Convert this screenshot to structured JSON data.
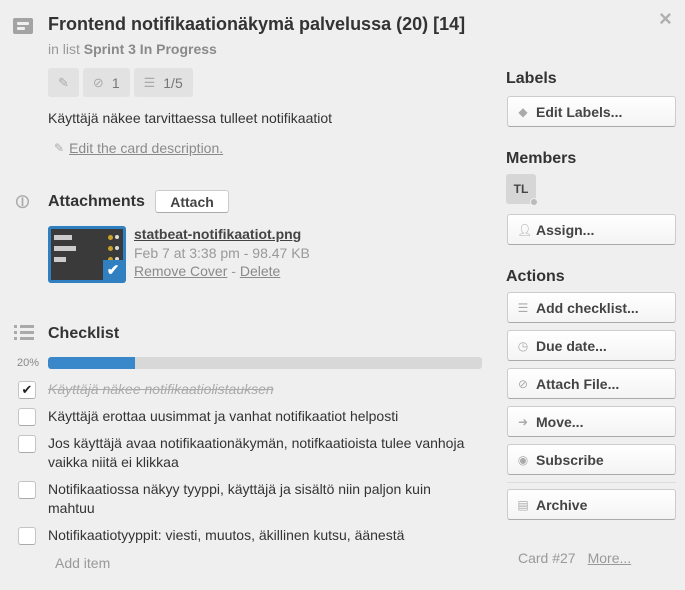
{
  "card": {
    "title": "Frontend notifikaationäkymä palvelussa (20) [14]",
    "in_list_prefix": "in list",
    "list_name": "Sprint 3 In Progress",
    "close_icon": "×",
    "badges": [
      {
        "icon": "pencil-icon",
        "glyph": "✎",
        "value": ""
      },
      {
        "icon": "paperclip-icon",
        "glyph": "⊘",
        "value": "1"
      },
      {
        "icon": "checklist-icon",
        "glyph": "☰",
        "value": "1/5"
      }
    ],
    "description": "Käyttäjä näkee tarvittaessa tulleet notifikaatiot",
    "edit_description_label": "Edit the card description."
  },
  "attachments": {
    "title": "Attachments",
    "attach_button": "Attach",
    "items": [
      {
        "filename": "statbeat-notifikaatiot.png",
        "meta": "Feb 7 at 3:38 pm - 98.47 KB",
        "remove_cover": "Remove Cover",
        "separator": " - ",
        "delete": "Delete",
        "is_cover": true
      }
    ]
  },
  "checklist": {
    "title": "Checklist",
    "progress_label": "20%",
    "progress": 0.2,
    "items": [
      {
        "text": "Käyttäjä näkee notifikaatiolistauksen",
        "checked": true
      },
      {
        "text": "Käyttäjä erottaa uusimmat ja vanhat notifikaatiot helposti",
        "checked": false
      },
      {
        "text": "Jos käyttäjä avaa notifikaationäkymän, notifkaatioista tulee vanhoja vaikka niitä ei klikkaa",
        "checked": false
      },
      {
        "text": "Notifikaatiossa näkyy tyyppi, käyttäjä ja sisältö niin paljon kuin mahtuu",
        "checked": false
      },
      {
        "text": "Notifikaatiotyyppit: viesti, muutos, äkillinen kutsu, äänestä",
        "checked": false
      }
    ],
    "add_item_label": "Add item",
    "check_glyph": "✔"
  },
  "sidebar": {
    "labels_heading": "Labels",
    "edit_labels": "Edit Labels...",
    "members_heading": "Members",
    "member_initials": "TL",
    "assign": "Assign...",
    "actions_heading": "Actions",
    "actions": [
      {
        "label": "Add checklist...",
        "icon": "checklist-icon",
        "glyph": "☰"
      },
      {
        "label": "Due date...",
        "icon": "clock-icon",
        "glyph": "◷"
      },
      {
        "label": "Attach File...",
        "icon": "paperclip-icon",
        "glyph": "⊘"
      },
      {
        "label": "Move...",
        "icon": "arrow-right-icon",
        "glyph": "➜"
      },
      {
        "label": "Subscribe",
        "icon": "eye-icon",
        "glyph": "◉"
      }
    ],
    "archive": "Archive",
    "card_number": "Card #27",
    "more": "More..."
  }
}
